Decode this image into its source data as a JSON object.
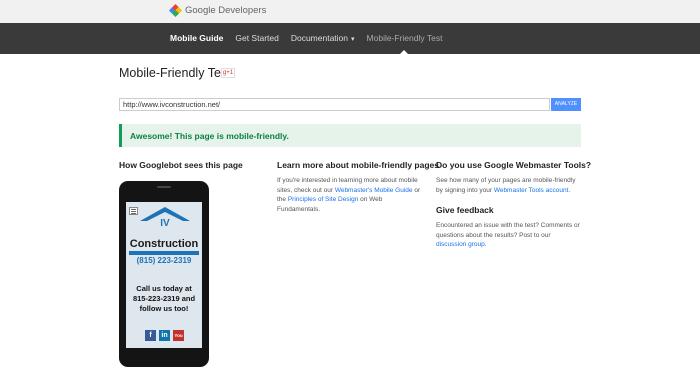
{
  "header": {
    "brand_google": "Google",
    "brand_developers": "Developers"
  },
  "nav": {
    "items": [
      {
        "label": "Mobile Guide"
      },
      {
        "label": "Get Started"
      },
      {
        "label": "Documentation"
      },
      {
        "label": "Mobile-Friendly Test"
      }
    ]
  },
  "main": {
    "title": "Mobile-Friendly Test",
    "gplus": "g+1",
    "url_value": "http://www.ivconstruction.net/",
    "analyze_label": "ANALYZE",
    "result_message": "Awesome! This page is mobile-friendly."
  },
  "preview": {
    "heading": "How Googlebot sees this page",
    "site": {
      "logo_text": "IV",
      "name": "Construction",
      "phone": "(815) 223-2319",
      "cta": "Call us today at 815-223-2319 and follow us too!",
      "social": [
        "f",
        "in",
        "You"
      ]
    }
  },
  "learn": {
    "heading": "Learn more about mobile-friendly pages",
    "text_1": "If you're interested in learning more about mobile sites, check out our ",
    "link_1": "Webmaster's Mobile Guide",
    "text_2": " or the ",
    "link_2": "Principles of Site Design",
    "text_3": " on Web Fundamentals."
  },
  "webmaster": {
    "heading": "Do you use Google Webmaster Tools?",
    "text_1": "See how many of your pages are mobile-friendly by signing into your ",
    "link_1": "Webmaster Tools account",
    "text_2": "."
  },
  "feedback": {
    "heading": "Give feedback",
    "text_1": "Encountered an issue with the test? Comments or questions about the results? Post to our ",
    "link_1": "discussion group",
    "text_2": "."
  },
  "colors": {
    "nav_bg": "#3a3a3a",
    "accent": "#4d90fe",
    "success": "#0f9d58",
    "link": "#1a73e8"
  }
}
